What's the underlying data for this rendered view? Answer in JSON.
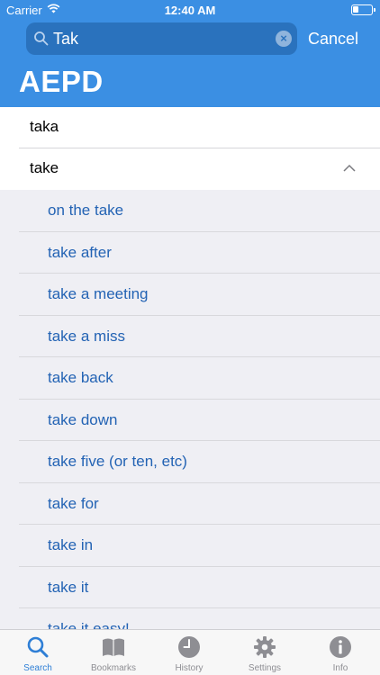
{
  "status_bar": {
    "carrier": "Carrier",
    "time": "12:40 AM"
  },
  "search": {
    "value": "Tak",
    "cancel_label": "Cancel"
  },
  "app_title": "AEPD",
  "results": [
    {
      "label": "taka",
      "expanded": false
    },
    {
      "label": "take",
      "expanded": true
    }
  ],
  "sub_entries": [
    "on the take",
    "take after",
    "take a meeting",
    "take a miss",
    "take back",
    "take down",
    "take five (or ten, etc)",
    "take for",
    "take in",
    "take it",
    "take it easy!"
  ],
  "tabs": [
    {
      "label": "Search",
      "icon": "search-icon",
      "active": true
    },
    {
      "label": "Bookmarks",
      "icon": "book-icon",
      "active": false
    },
    {
      "label": "History",
      "icon": "clock-icon",
      "active": false
    },
    {
      "label": "Settings",
      "icon": "gear-icon",
      "active": false
    },
    {
      "label": "Info",
      "icon": "info-icon",
      "active": false
    }
  ],
  "colors": {
    "accent": "#3b8fe3",
    "link": "#2363b4",
    "tab_active": "#2f7fd6",
    "tab_inactive": "#8e8e93"
  }
}
